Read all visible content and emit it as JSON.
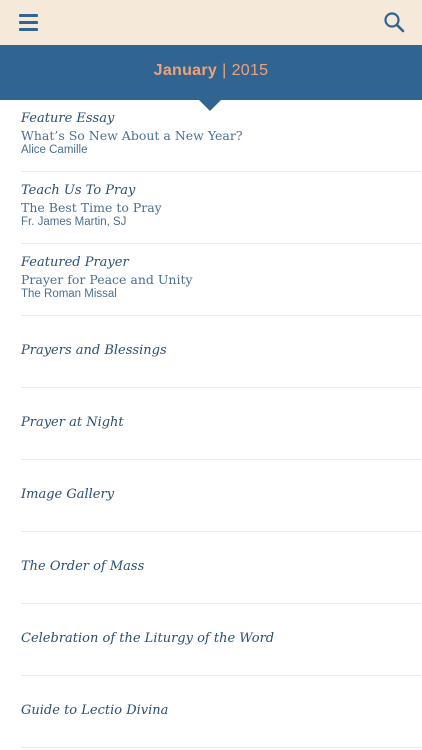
{
  "toolbar": {
    "menu_icon": "hamburger-menu-icon",
    "search_icon": "search-icon"
  },
  "header": {
    "month": "January",
    "separator": "|",
    "year": "2015"
  },
  "colors": {
    "topbar": "#f5e9da",
    "header": "#2f6590",
    "accent": "#f0a27a",
    "text": "#2a4f72"
  },
  "items": [
    {
      "category": "Feature Essay",
      "title": "What’s So New About a New Year?",
      "author": "Alice Camille"
    },
    {
      "category": "Teach Us To Pray",
      "title": "The Best Time to Pray",
      "author": "Fr. James Martin, SJ"
    },
    {
      "category": "Featured Prayer",
      "title": "Prayer for Peace and Unity",
      "author": "The Roman Missal"
    },
    {
      "category": "Prayers and Blessings"
    },
    {
      "category": "Prayer at Night"
    },
    {
      "category": "Image Gallery"
    },
    {
      "category": "The Order of Mass"
    },
    {
      "category": "Celebration of the Liturgy of the Word"
    },
    {
      "category": "Guide to Lectio Divina"
    }
  ]
}
